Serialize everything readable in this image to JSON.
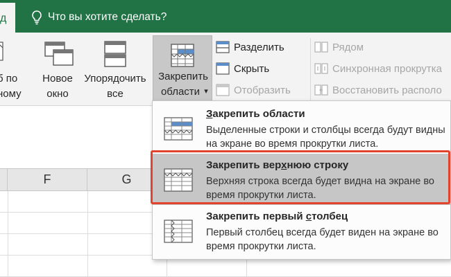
{
  "topbar": {
    "active_tab": "д",
    "tell_me": "Что вы хотите сделать?"
  },
  "ribbon": {
    "left_cut": {
      "line1": "б по",
      "line2": "ному"
    },
    "new_window": {
      "line1": "Новое",
      "line2": "окно"
    },
    "arrange": {
      "line1": "Упорядочить",
      "line2": "все"
    },
    "freeze": {
      "line1": "Закрепить",
      "line2": "области",
      "caret": "▾"
    },
    "split": "Разделить",
    "hide": "Скрыть",
    "unhide": "Отобразить",
    "side_by_side": "Рядом",
    "sync_scroll": "Синхронная прокрутка",
    "reset_position": "Восстановить располо"
  },
  "columns": [
    {
      "label": ""
    },
    {
      "label": "F"
    },
    {
      "label": "G"
    },
    {
      "label": ""
    },
    {
      "label": ""
    }
  ],
  "menu": {
    "items": [
      {
        "title_pre": "",
        "title_u": "З",
        "title_post": "акрепить области",
        "desc": "Выделенные строки и столбцы всегда будут видны на экране во время прокрутки листа."
      },
      {
        "title_pre": "Закрепить вер",
        "title_u": "х",
        "title_post": "нюю строку",
        "desc": "Верхняя строка всегда будет видна на экране во время прокрутки листа."
      },
      {
        "title_pre": "Закрепить первый ",
        "title_u": "с",
        "title_post": "толбец",
        "desc": "Первый столбец всегда будет виден на экране во время прокрутки листа."
      }
    ]
  },
  "colors": {
    "excel_green": "#217346",
    "highlight": "#c6c6c6",
    "callout_red": "#e3432c"
  }
}
